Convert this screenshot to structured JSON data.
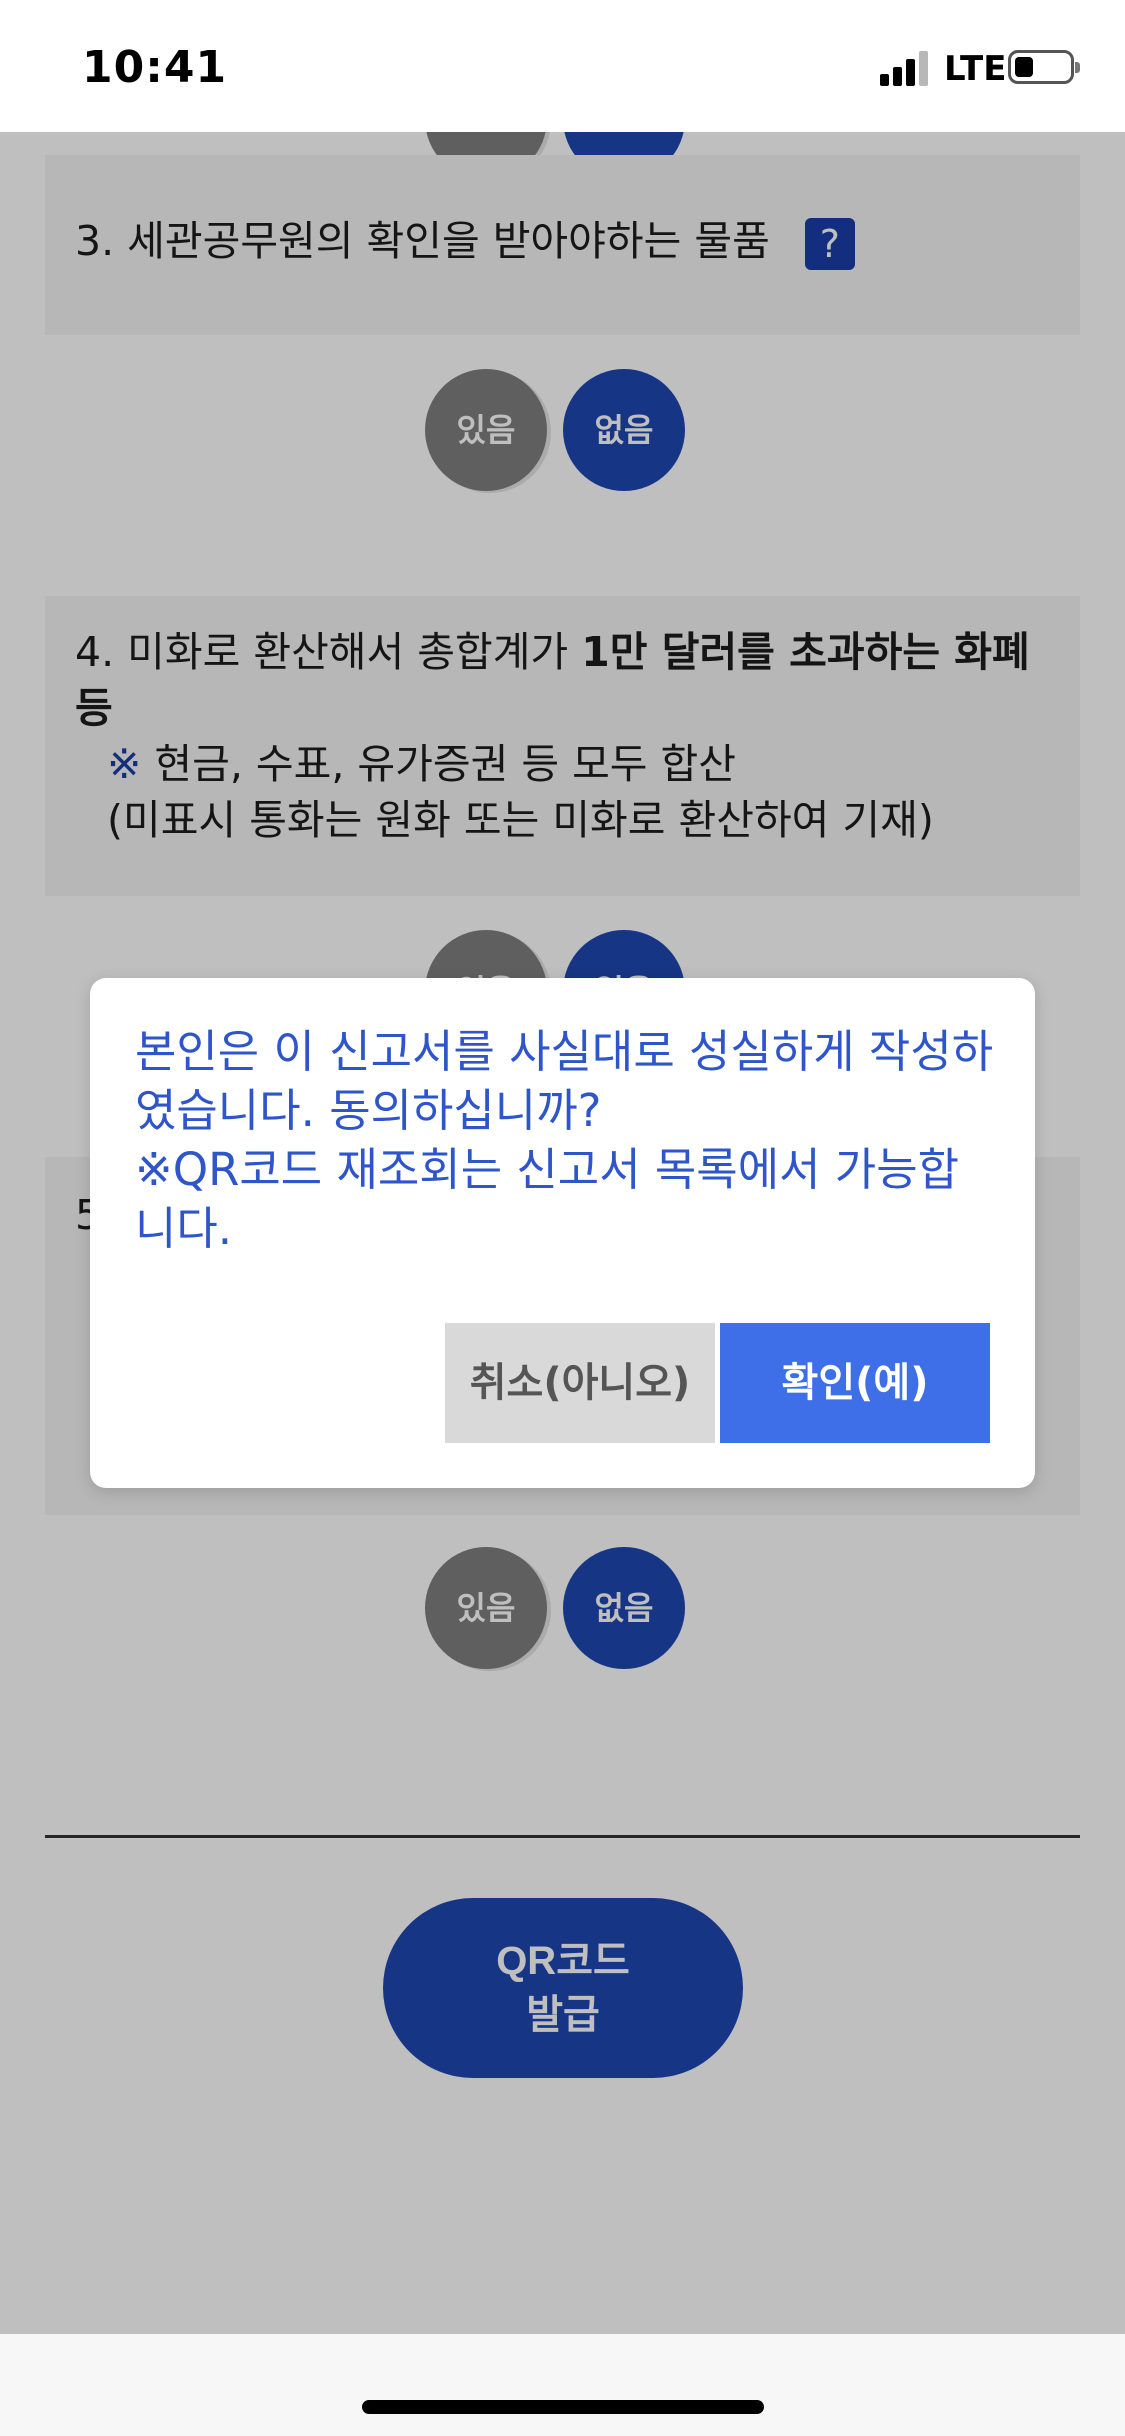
{
  "status_bar": {
    "time": "10:41",
    "network": "LTE"
  },
  "questions": [
    {
      "number": "3.",
      "text": "세관공무원의 확인을 받아야하는 물품",
      "help_symbol": "?"
    },
    {
      "number": "4.",
      "text_plain": "미화로 환산해서 총합계가",
      "text_bold": "1만 달러를 초과하는 화폐 등",
      "note_mark": "※",
      "note_line1": "현금, 수표, 유가증권 등 모두 합산",
      "note_line2": "(미표시 통화는 원화 또는 미화로 환산하여 기재)"
    },
    {
      "number": "5"
    }
  ],
  "choices": {
    "yes_label": "있음",
    "no_label": "없음"
  },
  "qr_button": {
    "line1": "QR코드",
    "line2": "발급"
  },
  "dialog": {
    "message_line1": "본인은 이 신고서를 사실대로 성실하게 작성하였습니다. 동의하십니까?",
    "message_line2": "※QR코드 재조회는 신고서 목록에서 가능합니다.",
    "cancel_label": "취소(아니오)",
    "confirm_label": "확인(예)"
  },
  "colors": {
    "primary": "#1f47b2",
    "dialog_text": "#2e55c9",
    "confirm_button": "#3f6fe8",
    "cancel_button": "#d9d9d9"
  }
}
